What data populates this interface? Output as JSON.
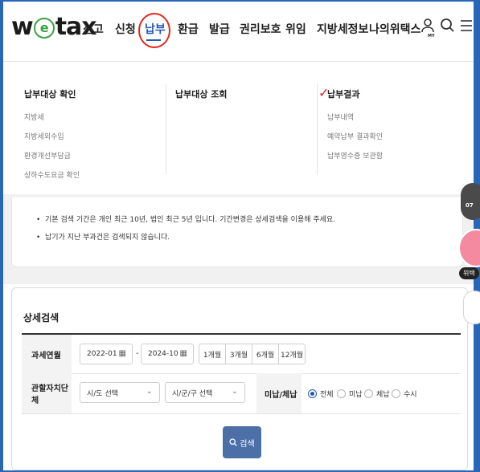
{
  "header": {
    "logo_pre": "w",
    "logo_e": "e",
    "logo_post": "tax",
    "nav": [
      "신고",
      "신청",
      "납부",
      "환급",
      "발급",
      "권리보호",
      "위임",
      "지방세정보",
      "나의위택스"
    ],
    "my_label": "MY"
  },
  "mega_menu": {
    "columns": [
      {
        "title": "납부대상 확인",
        "items": [
          "지방세",
          "지방세외수입",
          "환경개선부담금",
          "상하수도요금 확인"
        ]
      },
      {
        "title": "납부대상 조회",
        "items": []
      },
      {
        "title": "납부결과",
        "items": [
          "납부내역",
          "예약납부 결과확인",
          "납부영수증 보관함"
        ]
      }
    ]
  },
  "notice": {
    "items": [
      "기본 검색 기간은 개인 최근 10년, 법인 최근 5년 입니다. 기간변경은 상세검색을 이용해 주세요.",
      "납기가 지난 부과건은 검색되지 않습니다."
    ]
  },
  "detail_search": {
    "title": "상세검색",
    "period_label": "과세연월",
    "start": "2022-01",
    "end": "2024-10",
    "separator": "-",
    "period_buttons": [
      "1개월",
      "3개월",
      "6개월",
      "12개월"
    ],
    "region_label": "관할자치단체",
    "sido_placeholder": "시/도 선택",
    "sigungu_placeholder": "시/군/구 선택",
    "status_label": "미납/체납",
    "status_options": [
      "전체",
      "미납",
      "체납",
      "수시"
    ],
    "status_selected": "전체",
    "search_button": "검색"
  },
  "floating": {
    "badge1": "07",
    "badge2_label": "위택"
  },
  "colors": {
    "accent": "#2557b5",
    "annotation_red": "#e0281f",
    "search_button": "#4d6fa8",
    "logo_green": "#3aa145"
  }
}
